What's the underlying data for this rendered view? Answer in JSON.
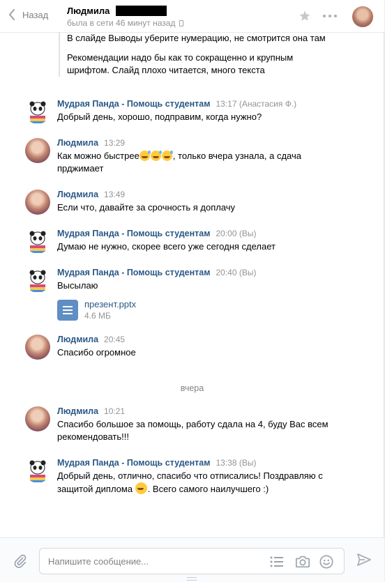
{
  "header": {
    "back_label": "Назад",
    "peer_name": "Людмила",
    "peer_status": "была в сети 46 минут назад"
  },
  "quote": {
    "lines": [
      "В слайде Выводы уберите нумерацию, не смотрится она там",
      "Рекомендации надо бы как то сокращенно и крупным шрифтом. Слайд плохо читается, много текста"
    ]
  },
  "messages": [
    {
      "author": "Мудрая Панда - Помощь студентам",
      "time": "13:17 (Анастасия Ф.)",
      "text": "Добрый день, хорошо, подправим, когда нужно?"
    },
    {
      "author": "Людмила",
      "time": "13:29",
      "text_before": "Как можно быстрее",
      "text_after": ", только вчера узнала, а сдача прджимает",
      "emoji": [
        "grinning-sweat-emoji",
        "grinning-sweat-emoji",
        "grinning-sweat-emoji"
      ]
    },
    {
      "author": "Людмила",
      "time": "13:49",
      "text": "Если что, давайте за срочность я доплачу"
    },
    {
      "author": "Мудрая Панда - Помощь студентам",
      "time": "20:00 (Вы)",
      "text": "Думаю не нужно, скорее всего уже сегодня сделает"
    },
    {
      "author": "Мудрая Панда - Помощь студентам",
      "time": "20:40 (Вы)",
      "text": "Высылаю",
      "attachment": {
        "name": "презент.pptx",
        "size": "4.6 МБ"
      }
    },
    {
      "author": "Людмила",
      "time": "20:45",
      "text": "Спасибо огромное"
    },
    {
      "author": "Людмила",
      "time": "10:21",
      "text": "Спасибо большое за помощь, работу сдала на 4, буду Вас всем рекомендовать!!!"
    },
    {
      "author": "Мудрая Панда - Помощь студентам",
      "time": "13:38 (Вы)",
      "text_before": "Добрый день, отлично, спасибо что отписались! Поздравляю с защитой диплома ",
      "text_after": ". Всего самого наилучшего :)",
      "emoji": [
        "smiling-emoji"
      ]
    }
  ],
  "date_separator": "вчера",
  "composer": {
    "placeholder": "Напишите сообщение..."
  },
  "colors": {
    "link": "#2a5885",
    "muted": "#939393",
    "doc_icon": "#5f8ec5"
  }
}
